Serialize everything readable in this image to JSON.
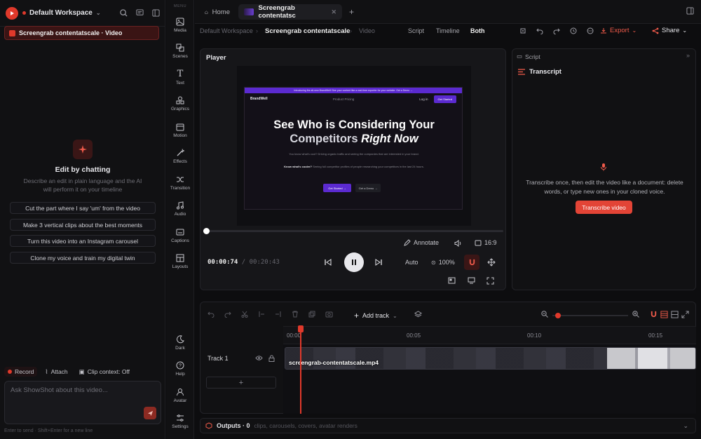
{
  "workspace": {
    "name": "Default Workspace",
    "chat_title": "Screengrab contentatscale · Video"
  },
  "chat": {
    "heading": "Edit by chatting",
    "description": "Describe an edit in plain language and the AI will perform it on your timeline",
    "suggestions": [
      "Cut the part where I say 'um' from the video",
      "Make 3 vertical clips about the best moments",
      "Turn this video into an Instagram carousel",
      "Clone my voice and train my digital twin"
    ],
    "record": "Record",
    "attach": "Attach",
    "clip_context": "Clip context: Off",
    "input_placeholder": "Ask ShowShot about this video...",
    "hint": "Enter to send · Shift+Enter for a new line"
  },
  "rail": {
    "menu_label": "MENU",
    "items": [
      "Media",
      "Scenes",
      "Text",
      "Graphics",
      "Motion",
      "Effects",
      "Transition",
      "Audio",
      "Captions",
      "Layouts"
    ],
    "bottom": [
      "Dark",
      "Help",
      "Avatar",
      "Settings"
    ]
  },
  "tabs": {
    "home": "Home",
    "current": "Screengrab contentatsc"
  },
  "breadcrumb": {
    "workspace": "Default Workspace",
    "title": "Screengrab contentatscale",
    "type": "Video"
  },
  "modes": [
    "Script",
    "Timeline",
    "Both"
  ],
  "actions": {
    "export": "Export",
    "share": "Share"
  },
  "player": {
    "title": "Player",
    "current_time": "00:00:74",
    "duration": "00:20:43",
    "annotate": "Annotate",
    "aspect": "16:9",
    "quality": "Auto",
    "zoom": "100%",
    "progress": 0.0
  },
  "preview_site": {
    "banner": "Introducing the all-new BrandWell! See your content like a real-time exporter for your website. Get a Demo →",
    "brand": "BrandWell",
    "nav_links": "Product   Pricing",
    "login": "Log in",
    "nav_cta": "Get Started",
    "hero_line1": "See Who is Considering Your",
    "hero_line2a": "Competitors ",
    "hero_line2b": "Right Now",
    "sub1": "You know what's cool? Driving organic traffic and seeing the companies that are interested in your brand.",
    "sub2_label": "Know what's cooler?",
    "sub2": "Seeing full competitor profiles of people researching your competitors in the last 24 hours.",
    "cta1": "Get Started →",
    "cta2": "Get a Demo →"
  },
  "script_panel": {
    "header": "Script",
    "title": "Transcript",
    "description": "Transcribe once, then edit the video like a document: delete words, or type new ones in your cloned voice.",
    "button": "Transcribe video"
  },
  "timeline": {
    "add_track": "Add track",
    "ticks": [
      "00:00",
      "00:05",
      "00:10",
      "00:15"
    ],
    "track_label": "Track 1",
    "clip_name": "screengrab-contentatscale.mp4"
  },
  "outputs": {
    "label": "Outputs · 0",
    "description": "clips, carousels, covers, avatar renders"
  },
  "colors": {
    "accent": "#e0392b",
    "brand_purple": "#5b2ad0",
    "bg": "#0d0d0f"
  }
}
